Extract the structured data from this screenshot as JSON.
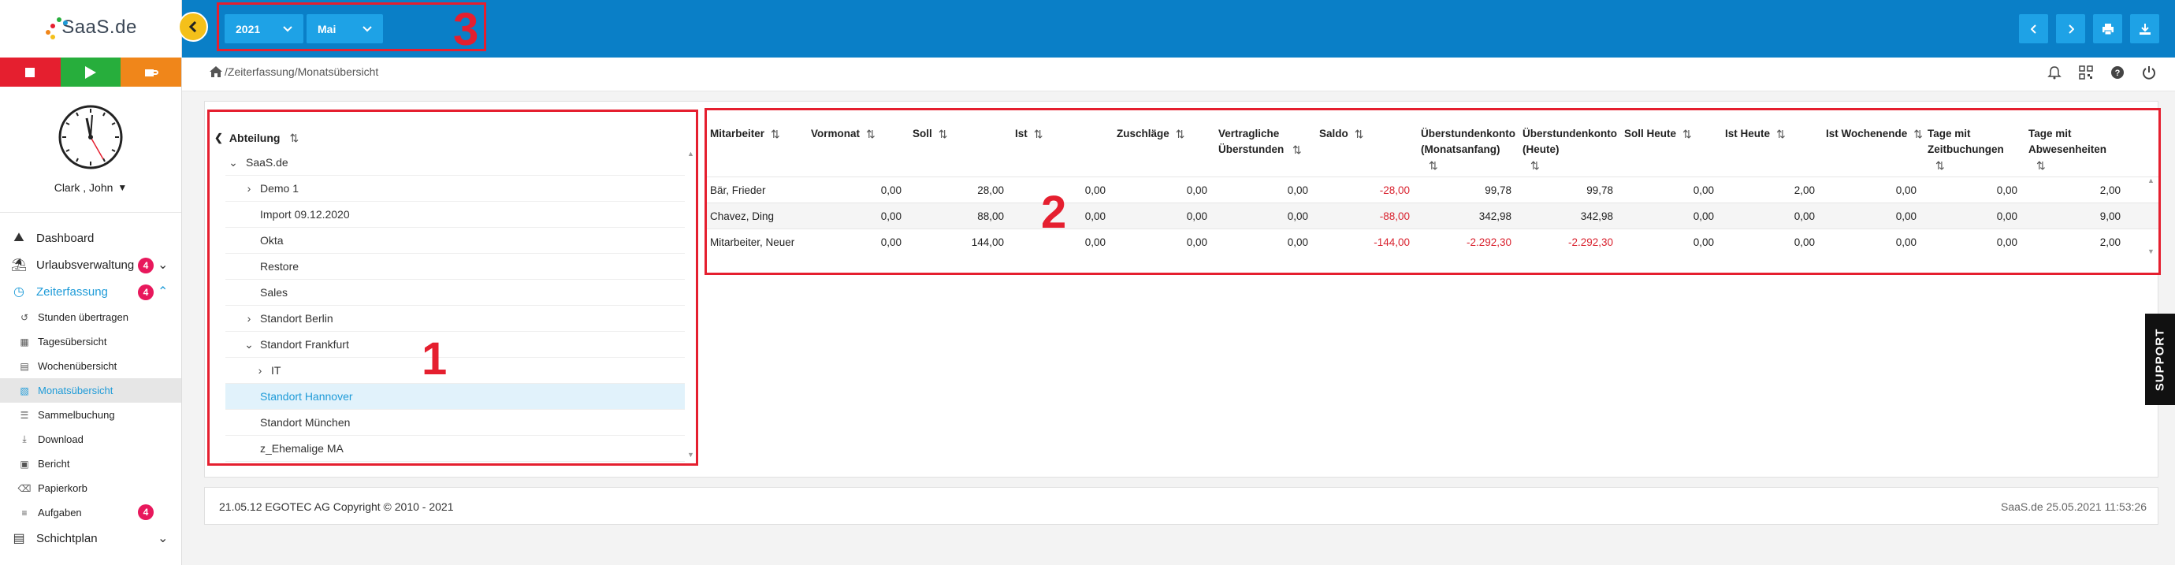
{
  "app": {
    "logo_text": "SaaS",
    "logo_suffix": ".de"
  },
  "timer": {
    "stop_icon": "stop-icon",
    "play_icon": "play-icon",
    "break_icon": "coffee-icon"
  },
  "user": {
    "name": "Clark , John"
  },
  "sidebar": {
    "items": [
      {
        "label": "Dashboard",
        "icon": "dashboard-icon"
      },
      {
        "label": "Urlaubsverwaltung",
        "icon": "beach-icon",
        "badge": "4"
      },
      {
        "label": "Zeiterfassung",
        "icon": "clock-icon",
        "badge": "4"
      }
    ],
    "subitems": [
      {
        "label": "Stunden übertragen"
      },
      {
        "label": "Tagesübersicht"
      },
      {
        "label": "Wochenübersicht"
      },
      {
        "label": "Monatsübersicht"
      },
      {
        "label": "Sammelbuchung"
      },
      {
        "label": "Download"
      },
      {
        "label": "Bericht"
      },
      {
        "label": "Papierkorb"
      },
      {
        "label": "Aufgaben",
        "badge": "4"
      }
    ],
    "last_item": {
      "label": "Schichtplan"
    }
  },
  "topbar": {
    "year": "2021",
    "month": "Mai",
    "annotation": "3",
    "accent": "#0a7fc7",
    "button_color": "#1ea2e6"
  },
  "breadcrumb": {
    "text": "/Zeiterfassung/Monatsübersicht"
  },
  "tree": {
    "header": "Abteilung",
    "annotation": "1",
    "rows": [
      {
        "label": "SaaS.de"
      },
      {
        "label": "Demo 1"
      },
      {
        "label": "Import 09.12.2020"
      },
      {
        "label": "Okta"
      },
      {
        "label": "Restore"
      },
      {
        "label": "Sales"
      },
      {
        "label": "Standort Berlin"
      },
      {
        "label": "Standort Frankfurt"
      },
      {
        "label": "IT"
      },
      {
        "label": "Standort Hannover"
      },
      {
        "label": "Standort München"
      },
      {
        "label": "z_Ehemalige MA"
      }
    ]
  },
  "table": {
    "annotation": "2",
    "headers": [
      {
        "line1": "Mitarbeiter",
        "line2": ""
      },
      {
        "line1": "Vormonat",
        "line2": ""
      },
      {
        "line1": "Soll",
        "line2": ""
      },
      {
        "line1": "Ist",
        "line2": ""
      },
      {
        "line1": "Zuschläge",
        "line2": ""
      },
      {
        "line1": "Vertragliche",
        "line2": "Überstunden"
      },
      {
        "line1": "Saldo",
        "line2": ""
      },
      {
        "line1": "Überstundenkonto",
        "line2": "(Monatsanfang)"
      },
      {
        "line1": "Überstundenkonto",
        "line2": "(Heute)"
      },
      {
        "line1": "Soll Heute",
        "line2": ""
      },
      {
        "line1": "Ist Heute",
        "line2": ""
      },
      {
        "line1": "Ist Wochenende",
        "line2": ""
      },
      {
        "line1": "Tage mit",
        "line2": "Zeitbuchungen"
      },
      {
        "line1": "Tage mit",
        "line2": "Abwesenheiten"
      }
    ],
    "rows": [
      [
        "Bär, Frieder",
        "0,00",
        "28,00",
        "0,00",
        "0,00",
        "0,00",
        "-28,00",
        "99,78",
        "99,78",
        "0,00",
        "2,00",
        "0,00",
        "0,00",
        "2,00"
      ],
      [
        "Chavez, Ding",
        "0,00",
        "88,00",
        "0,00",
        "0,00",
        "0,00",
        "-88,00",
        "342,98",
        "342,98",
        "0,00",
        "0,00",
        "0,00",
        "0,00",
        "9,00"
      ],
      [
        "Mitarbeiter, Neuer",
        "0,00",
        "144,00",
        "0,00",
        "0,00",
        "0,00",
        "-144,00",
        "-2.292,30",
        "-2.292,30",
        "0,00",
        "0,00",
        "0,00",
        "0,00",
        "2,00"
      ]
    ],
    "negative_color": "#d9232f"
  },
  "footer": {
    "left": "21.05.12 EGOTEC AG Copyright © 2010 - 2021",
    "right": "SaaS.de  25.05.2021 11:53:26"
  },
  "support": {
    "label": "SUPPORT"
  }
}
